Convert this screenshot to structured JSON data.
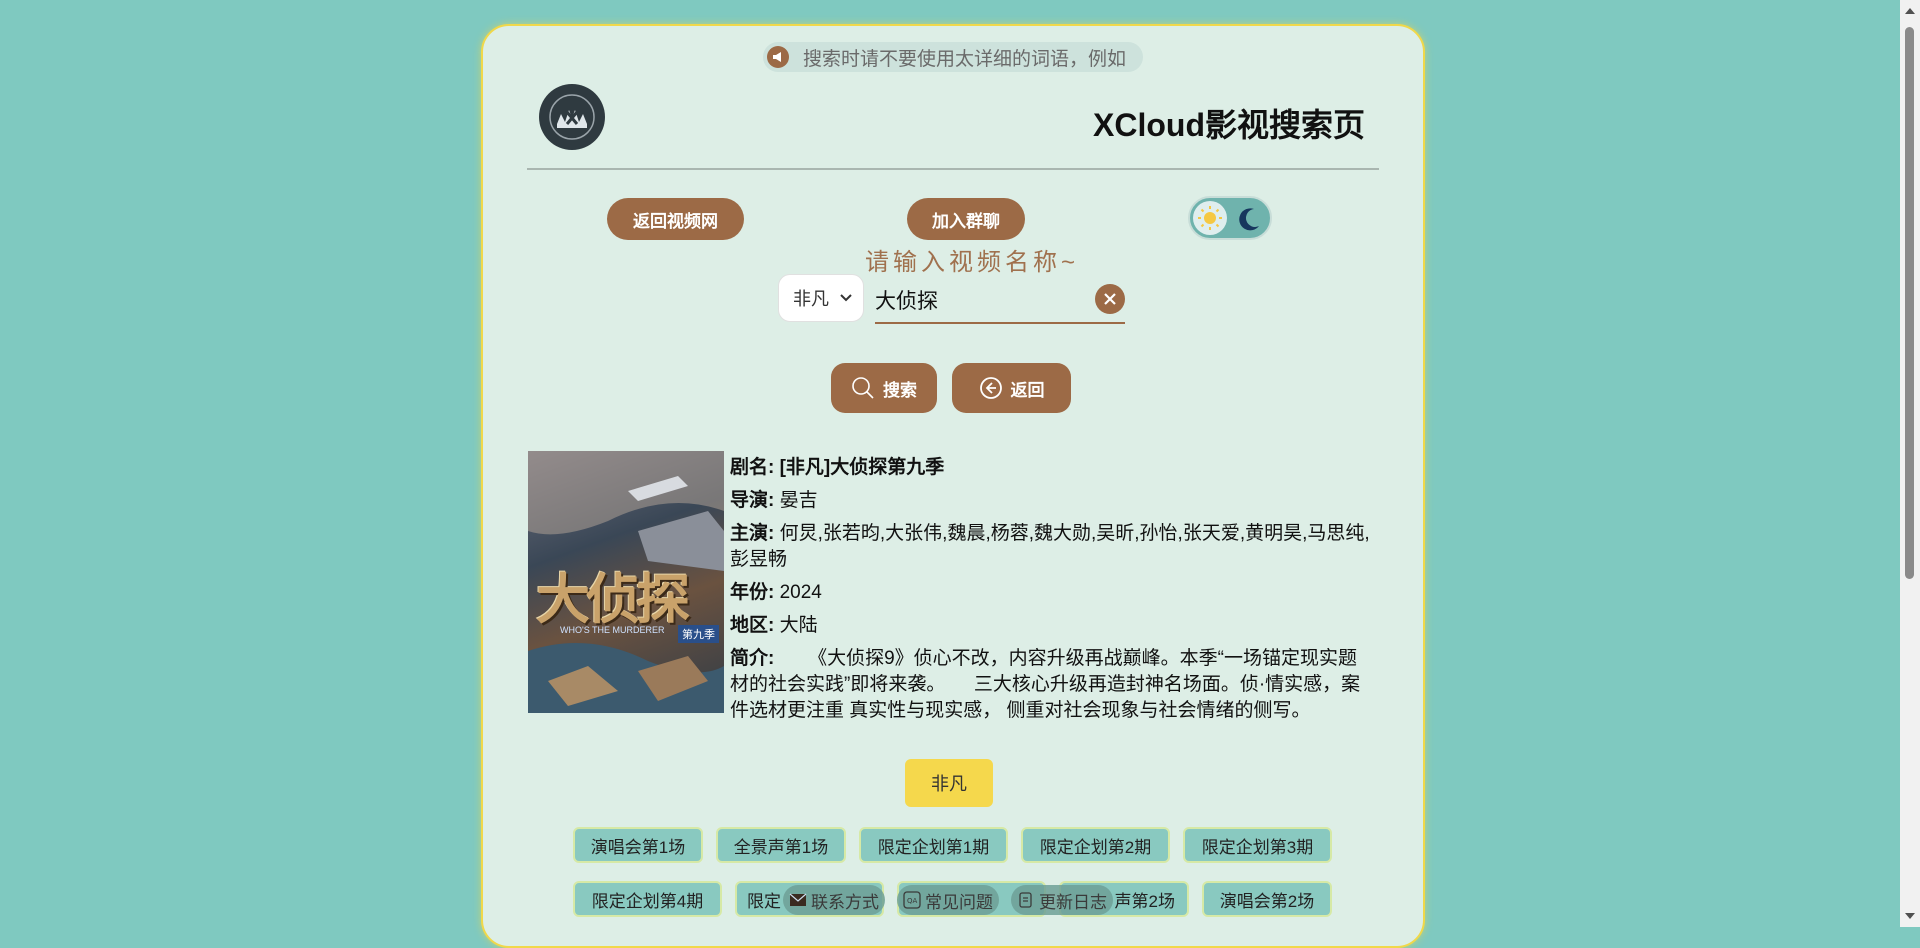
{
  "notice": {
    "text": "搜索时请不要使用太详细的词语，例如"
  },
  "header": {
    "site_title": "XCloud影视搜索页"
  },
  "nav": {
    "back_to_site": "返回视频网",
    "join_group": "加入群聊"
  },
  "search": {
    "prompt": "请输入视频名称~",
    "source_selected": "非凡",
    "query": "大侦探",
    "search_label": "搜索",
    "back_label": "返回"
  },
  "result": {
    "title_label": "剧名:",
    "title": "[非凡]大侦探第九季",
    "director_label": "导演:",
    "director": "晏吉",
    "cast_label": "主演:",
    "cast": "何炅,张若昀,大张伟,魏晨,杨蓉,魏大勋,吴昕,孙怡,张天爱,黄明昊,马思纯,彭昱畅",
    "year_label": "年份:",
    "year": "2024",
    "region_label": "地区:",
    "region": "大陆",
    "intro_label": "简介:",
    "intro": "　　《大侦探9》侦心不改，内容升级再战巅峰。本季“一场锚定现实题材的社会实践”即将来袭。　　三大核心升级再造封神名场面。侦·情实感，案件选材更注重 真实性与现实感， 侧重对社会现象与社会情绪的侧写。",
    "poster_title": "大侦探",
    "poster_subtitle": "WHO'S THE MURDERER",
    "poster_season": "第九季",
    "source_tab": "非凡"
  },
  "episodes": {
    "row1": [
      "演唱会第1场",
      "全景声第1场",
      "限定企划第1期",
      "限定企划第2期",
      "限定企划第3期"
    ],
    "row2": [
      "限定企划第4期",
      "限定",
      "",
      "声第2场",
      "演唱会第2场"
    ]
  },
  "footer": {
    "contact": "联系方式",
    "faq": "常见问题",
    "changelog": "更新日志"
  },
  "colors": {
    "accent_brown": "#9c6a46",
    "background_teal": "#7fc9c0",
    "card_bg": "#ddeee6",
    "highlight_yellow": "#f5d84c"
  }
}
